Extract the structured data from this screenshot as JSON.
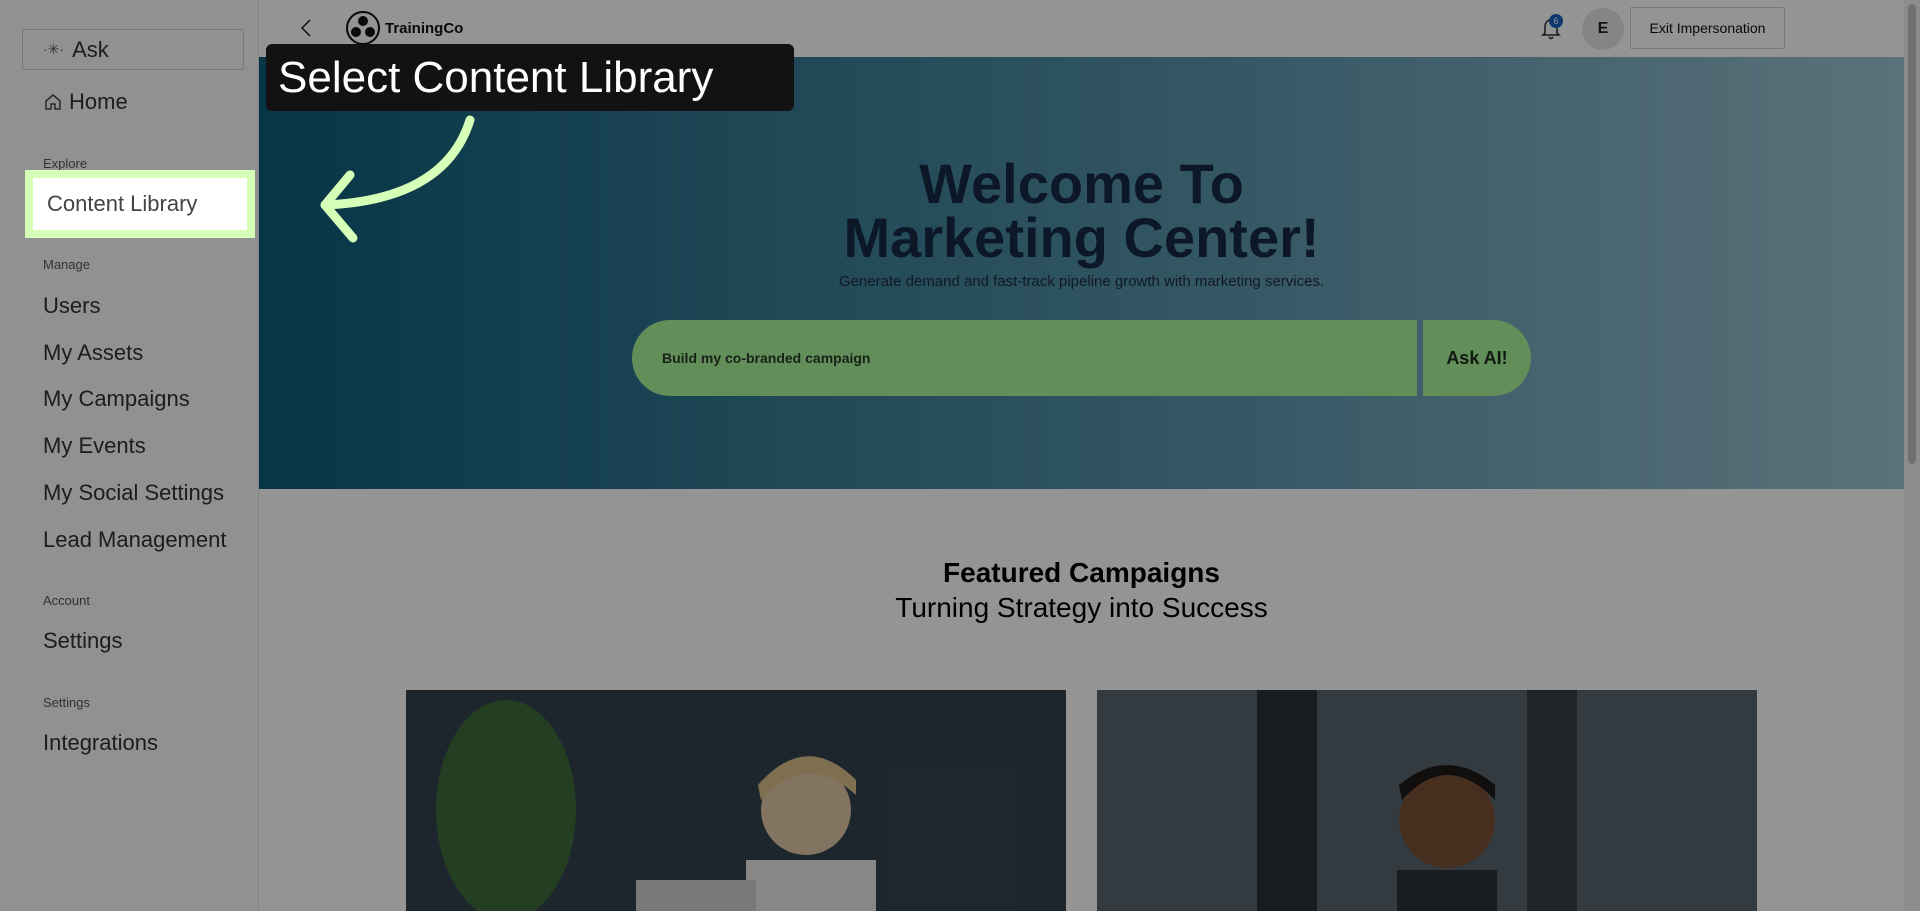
{
  "sidebar": {
    "ask_label": "Ask",
    "home_label": "Home",
    "sections": {
      "explore": "Explore",
      "manage": "Manage",
      "account": "Account",
      "settings": "Settings"
    },
    "items": {
      "content_library": "Content Library",
      "users": "Users",
      "my_assets": "My Assets",
      "my_campaigns": "My Campaigns",
      "my_events": "My Events",
      "my_social_settings": "My Social Settings",
      "lead_management": "Lead Management",
      "settings": "Settings",
      "integrations": "Integrations"
    }
  },
  "header": {
    "logo_text": "TrainingCo",
    "exit_label": "Exit Impersonation",
    "notification_count": "6",
    "avatar_initial": "E"
  },
  "hero": {
    "title_line1": "Welcome To",
    "title_line2": "Marketing Center!",
    "subtitle": "Generate demand and fast-track pipeline growth with marketing services.",
    "input_value": "Build my co-branded campaign",
    "ask_button": "Ask AI!"
  },
  "featured": {
    "title": "Featured Campaigns",
    "subtitle": "Turning Strategy into Success"
  },
  "overlay": {
    "tooltip_text": "Select Content Library",
    "highlight_color": "#d6ffb8"
  }
}
